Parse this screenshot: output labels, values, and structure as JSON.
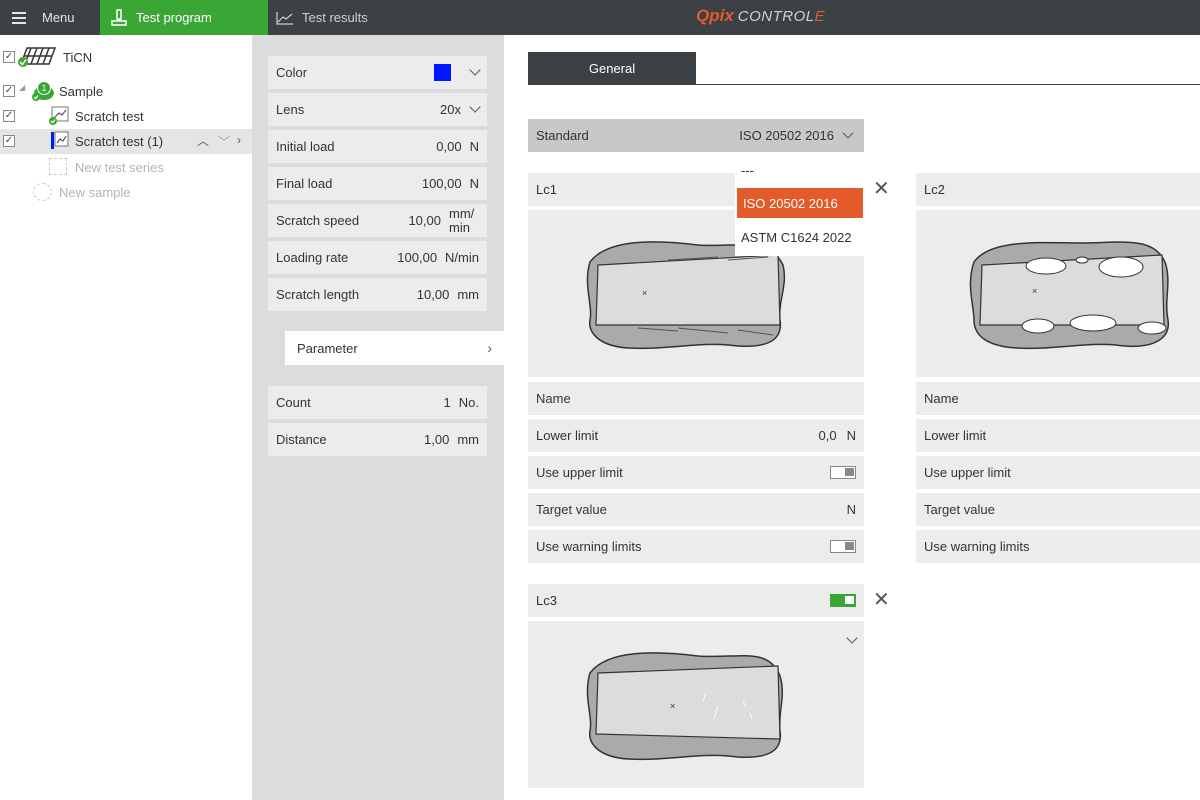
{
  "topbar": {
    "menu_label": "Menu",
    "program_label": "Test program",
    "results_label": "Test results",
    "logo": {
      "q": "Q",
      "pix": "pix",
      "control": "CONTROL",
      "e": "E"
    }
  },
  "tree": {
    "items": [
      {
        "label": "TiCN",
        "checked": true
      },
      {
        "label": "Sample",
        "checked": true,
        "badge": "1"
      },
      {
        "label": "Scratch test",
        "checked": true
      },
      {
        "label": "Scratch test (1)",
        "checked": true
      },
      {
        "label": "New test series"
      },
      {
        "label": "New sample"
      }
    ],
    "check_mark": "✓"
  },
  "settings": {
    "color_label": "Color",
    "color_value": "#0018ff",
    "fields": [
      {
        "label": "Lens",
        "value": "20x"
      },
      {
        "label": "Initial load",
        "value": "0,00",
        "unit": "N"
      },
      {
        "label": "Final load",
        "value": "100,00",
        "unit": "N"
      },
      {
        "label": "Scratch speed",
        "value": "10,00",
        "unit": "mm/ min"
      },
      {
        "label": "Loading rate",
        "value": "100,00",
        "unit": "N/min"
      },
      {
        "label": "Scratch length",
        "value": "10,00",
        "unit": "mm"
      }
    ],
    "parameter_label": "Parameter",
    "count": {
      "label": "Count",
      "value": "1",
      "unit": "No."
    },
    "distance": {
      "label": "Distance",
      "value": "1,00",
      "unit": "mm"
    }
  },
  "main": {
    "tab_general": "General",
    "standard_label": "Standard",
    "standard_value": "ISO 20502 2016",
    "dropdown_options": [
      "---",
      "ISO 20502 2016",
      "ASTM C1624 2022"
    ],
    "lc1": {
      "title": "Lc1",
      "name_label": "Name",
      "lower_label": "Lower limit",
      "lower_value": "0,0",
      "lower_unit": "N",
      "upper_label": "Use upper limit",
      "target_label": "Target value",
      "target_unit": "N",
      "warn_label": "Use warning limits"
    },
    "lc2": {
      "title": "Lc2",
      "name_label": "Name",
      "lower_label": "Lower limit",
      "upper_label": "Use upper limit",
      "target_label": "Target value",
      "warn_label": "Use warning limits"
    },
    "lc3": {
      "title": "Lc3"
    }
  }
}
